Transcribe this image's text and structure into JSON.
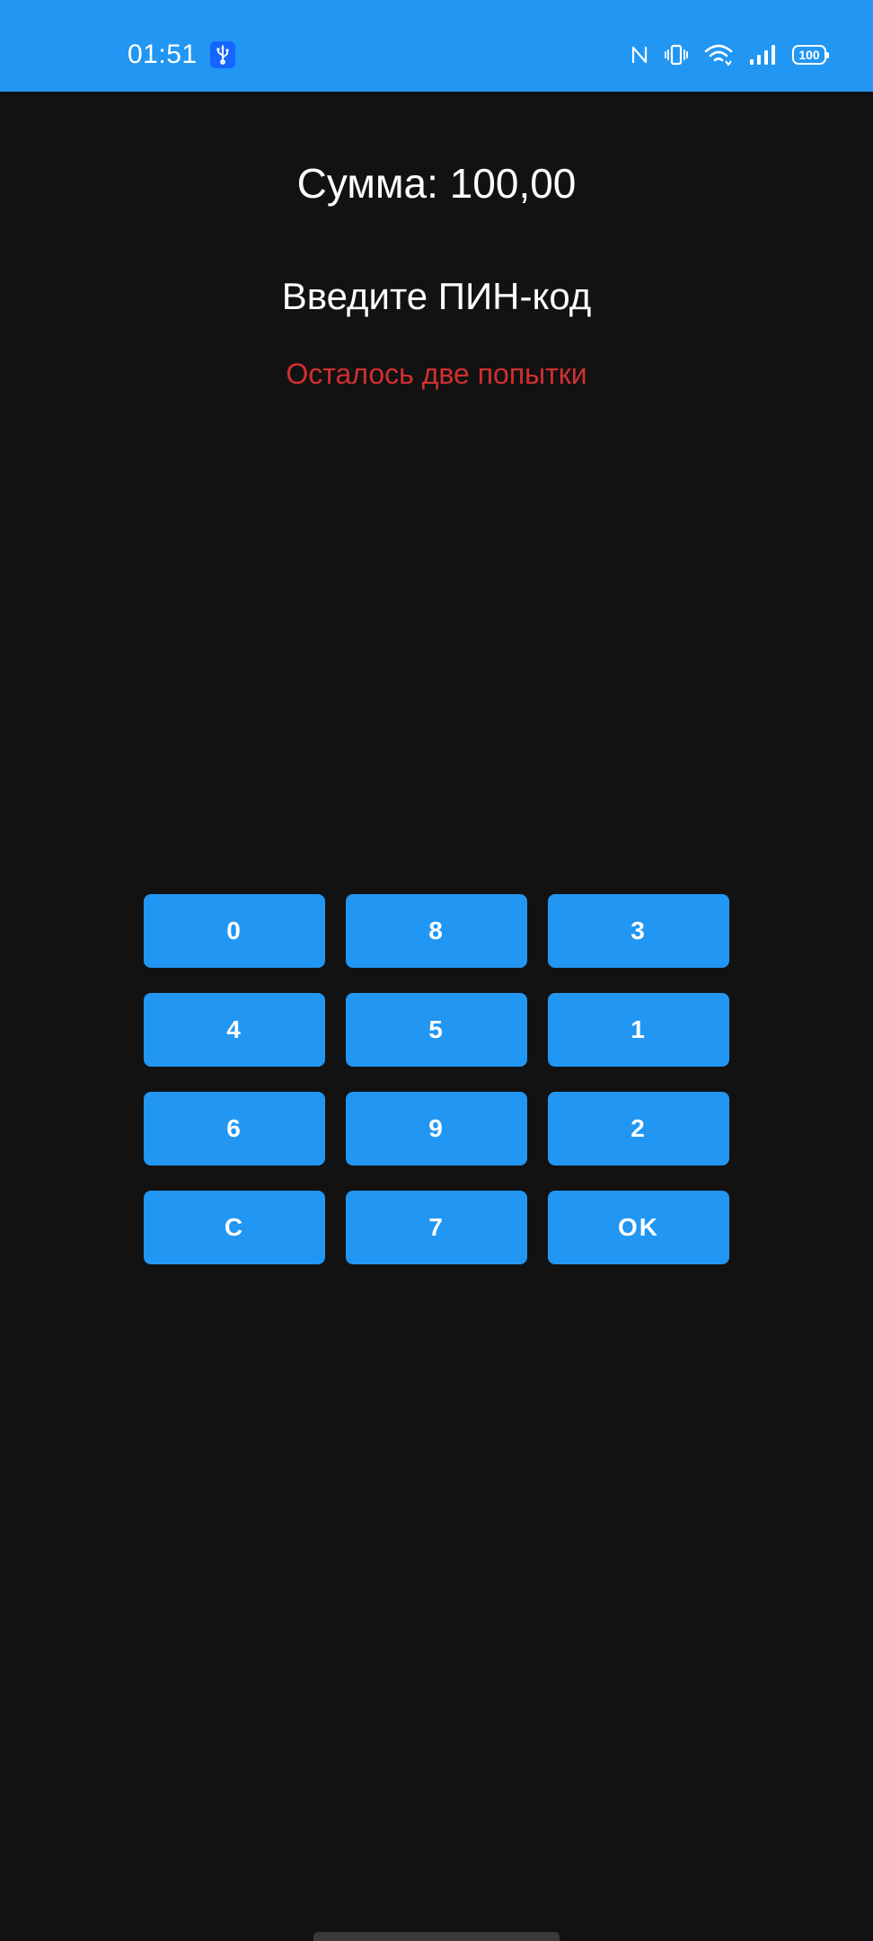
{
  "status_bar": {
    "time": "01:51",
    "battery": "100",
    "icons": [
      "usb-icon",
      "nfc-icon",
      "vibrate-icon",
      "wifi-icon",
      "signal-icon",
      "battery-icon"
    ],
    "color": "#2196f3"
  },
  "payment": {
    "amount_text": "Сумма: 100,00",
    "prompt": "Введите ПИН-код",
    "attempts_text": "Осталось две попытки",
    "attempts_color": "#d32f2f"
  },
  "keypad": {
    "key_color": "#2196f3",
    "keys": [
      "0",
      "8",
      "3",
      "4",
      "5",
      "1",
      "6",
      "9",
      "2",
      "C",
      "7",
      "OK"
    ]
  }
}
